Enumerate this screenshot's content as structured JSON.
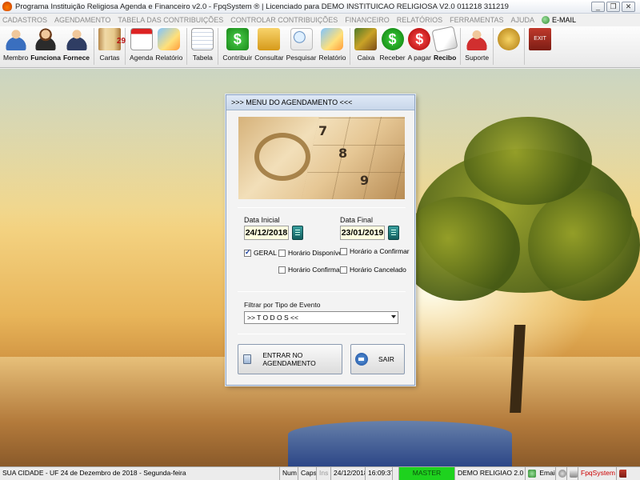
{
  "window": {
    "title": "Programa Instituição Religiosa Agenda e Financeiro v2.0 - FpqSystem ® | Licenciado para  DEMO INSTITUICAO RELIGIOSA V2.0 011218 311219",
    "buttons": [
      "_",
      "❐",
      "✕"
    ]
  },
  "menu": {
    "items": [
      "CADASTROS",
      "AGENDAMENTO",
      "TABELA DAS CONTRIBUIÇÕES",
      "CONTROLAR CONTRIBUIÇÕES",
      "FINANCEIRO",
      "RELATÓRIOS",
      "FERRAMENTAS",
      "AJUDA"
    ],
    "email_label": "E-MAIL"
  },
  "toolbar": {
    "membro": "Membro",
    "funciona": "Funciona",
    "fornece": "Fornece",
    "cartas": "Cartas",
    "agenda": "Agenda",
    "relatorio1": "Relatório",
    "tabela": "Tabela",
    "contribuir": "Contribuir",
    "consultar": "Consultar",
    "pesquisar": "Pesquisar",
    "relatorio2": "Relatório",
    "caixa": "Caixa",
    "receber": "Receber",
    "apagar": "A pagar",
    "recibo": "Recibo",
    "suporte": "Suporte",
    "calendar_day": "29",
    "exit_text": "EXIT"
  },
  "dialog": {
    "title": ">>>  MENU DO AGENDAMENTO  <<<",
    "photo_numbers": [
      "7",
      "8",
      "9"
    ],
    "data_inicial_label": "Data Inicial",
    "data_inicial_value": "24/12/2018",
    "data_final_label": "Data Final",
    "data_final_value": "23/01/2019",
    "checkboxes": {
      "geral": {
        "label": "GERAL",
        "checked": true
      },
      "disponivel": {
        "label": "Horário  Disponível",
        "checked": false
      },
      "a_confirmar": {
        "label": "Horário a Confirmar",
        "checked": false
      },
      "confirmado": {
        "label": "Horário Confirmado",
        "checked": false
      },
      "cancelado": {
        "label": "Horário Cancelado",
        "checked": false
      }
    },
    "filtro_label": "Filtrar por Tipo de Evento",
    "filtro_value": ">> T O D O S <<",
    "enter_button": "ENTRAR NO AGENDAMENTO",
    "exit_button": "SAIR"
  },
  "statusbar": {
    "location": "SUA CIDADE - UF 24 de Dezembro de 2018 - Segunda-feira",
    "num": "Num",
    "caps": "Caps",
    "ins": "Ins",
    "date": "24/12/2018",
    "time": "16:09:37",
    "master": "MASTER",
    "version": "DEMO RELIGIAO 2.0",
    "email": "Email",
    "brand": "FpqSystem"
  },
  "colors": {
    "master_bg": "#1ed21e",
    "date_field_bg": "#ffffe0",
    "dialog_title_bg": "#c8d7ea"
  }
}
